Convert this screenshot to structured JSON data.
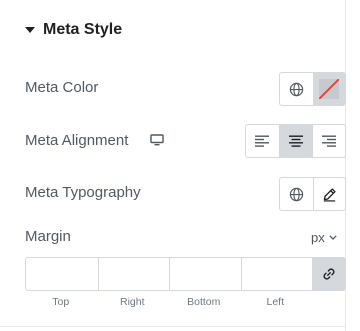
{
  "section": {
    "title": "Meta Style"
  },
  "rows": {
    "color_label": "Meta Color",
    "alignment_label": "Meta Alignment",
    "typography_label": "Meta Typography",
    "margin_label": "Margin"
  },
  "alignment": {
    "options": [
      "left",
      "center",
      "right"
    ],
    "selected": "center"
  },
  "margin": {
    "unit": "px",
    "values": {
      "top": "",
      "right": "",
      "bottom": "",
      "left": ""
    },
    "sides": [
      "Top",
      "Right",
      "Bottom",
      "Left"
    ],
    "linked": true
  },
  "colors": {
    "active_bg": "#d5d8dc",
    "border": "#d5d8dc",
    "text": "#515962",
    "title": "#1f2124",
    "swatch_slash": "#e0443f"
  }
}
